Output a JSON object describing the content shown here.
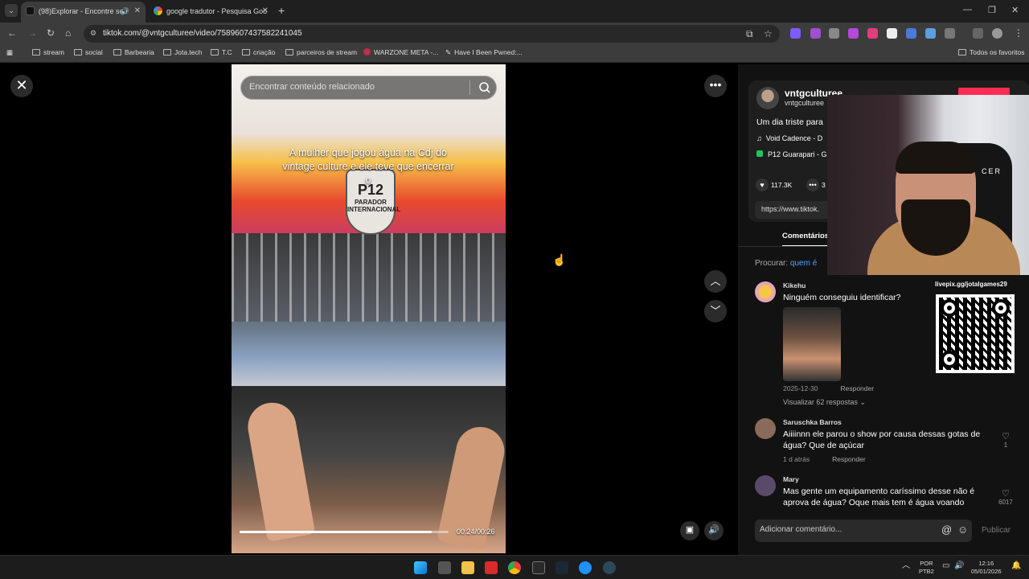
{
  "browser": {
    "tabs": [
      {
        "label": "(98)Explorar - Encontre seu",
        "active": true
      },
      {
        "label": "google tradutor - Pesquisa Goo",
        "active": false
      }
    ],
    "url": "tiktok.com/@vntgculturee/video/7589607437582241045",
    "bookmarks": [
      "stream",
      "social",
      "Barbearia",
      "Jota.tech",
      "T.C",
      "criação",
      "parceiros de stream",
      "WARZONE META -...",
      "Have I Been Pwned:..."
    ],
    "all_bookmarks": "Todos os favoritos"
  },
  "player": {
    "search_placeholder": "Encontrar conteúdo relacionado",
    "caption": "A mulher que jogou água na Cdj do vintage culture e ele teve que encerrar o",
    "sign_text": "P12",
    "sign_sub": "PARADOR INTERNACIONAL",
    "time": "00:24/00:26",
    "progress": 0.92
  },
  "post": {
    "author": "vntgculturee",
    "handle": "vntgculturee",
    "description": "Um dia triste para",
    "music": "Void Cadence - D",
    "location": "P12 Guarapari - Gu",
    "likes": "117.3K",
    "comments_count": "3",
    "link": "https://www.tiktok.",
    "tab_comments": "Comentários",
    "search_prefix": "Procurar:",
    "search_term": "quem é"
  },
  "comments": [
    {
      "user": "Kikehu",
      "text": "Ninguém conseguiu identificar?",
      "date": "2025-12-30",
      "reply": "Responder",
      "view_replies": "Visualizar 62 respostas ⌄"
    },
    {
      "user": "Saruschka Barros",
      "text": "Aiiiinnn ele parou o show por causa dessas gotas de água? Que de açúcar",
      "date": "1 d atrás",
      "reply": "Responder",
      "likes": "1"
    },
    {
      "user": "Mary",
      "text": "Mas gente um equipamento caríssimo desse não é aprova de água? Oque mais tem é água voando",
      "likes": "6017"
    }
  ],
  "composer": {
    "placeholder": "Adicionar comentário...",
    "publish": "Publicar"
  },
  "overlay": {
    "qr_label": "livepix.gg/jotalgames29",
    "webcam_text": "CER"
  },
  "taskbar": {
    "lang": "POR",
    "layout": "PTB2",
    "time": "12:16",
    "date": "05/01/2026"
  },
  "colors": {
    "accent": "#fe2c55",
    "link": "#4ea1ff",
    "location_icon": "#22c55e"
  }
}
